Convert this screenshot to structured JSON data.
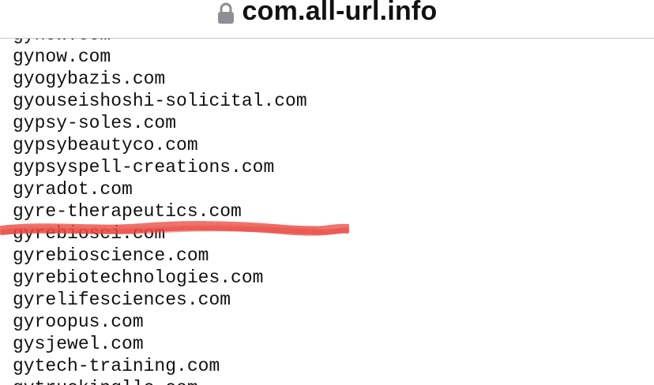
{
  "address_bar": {
    "domain": "com.all-url.info",
    "lock_icon": "lock-icon"
  },
  "domains": [
    "gynow.com",
    "gynow.com",
    "gyogybazis.com",
    "gyouseishoshi-solicital.com",
    "gypsy-soles.com",
    "gypsybeautyco.com",
    "gypsyspell-creations.com",
    "gyradot.com",
    "gyre-therapeutics.com",
    "gyrebiosci.com",
    "gyrebioscience.com",
    "gyrebiotechnologies.com",
    "gyrelifesciences.com",
    "gyroopus.com",
    "gysjewel.com",
    "gytech-training.com",
    "gytruckingllc.com"
  ],
  "highlighted_domain": "gyrebiosci.com",
  "colors": {
    "highlight_stroke": "#e8473f",
    "text": "#111111",
    "lock": "#8e8e93"
  }
}
